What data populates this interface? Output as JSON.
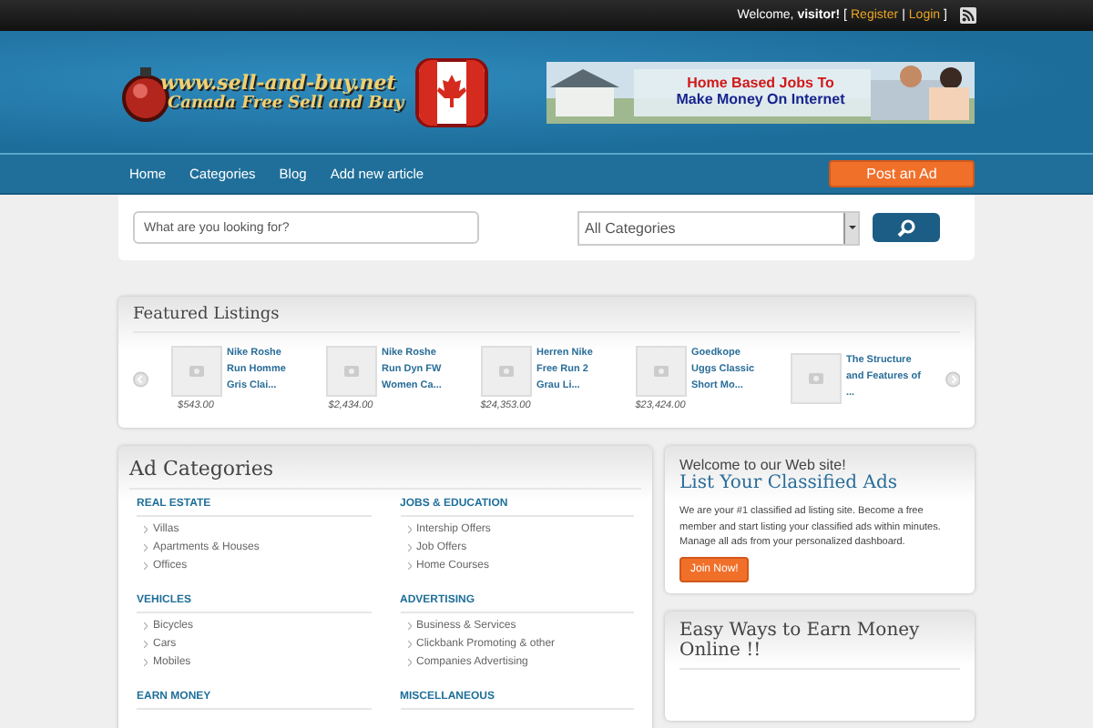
{
  "topbar": {
    "welcome": "Welcome,",
    "user": "visitor!",
    "open_bracket": "[",
    "register": "Register",
    "separator": "|",
    "login": "Login",
    "close_bracket": "]"
  },
  "logo": {
    "site": "www.sell-and-buy.net",
    "tagline": "Canada Free Sell and Buy"
  },
  "banner": {
    "line1": "Home Based Jobs To",
    "line2": "Make Money On Internet"
  },
  "nav": {
    "items": [
      "Home",
      "Categories",
      "Blog",
      "Add new article"
    ],
    "post_button": "Post an Ad"
  },
  "search": {
    "placeholder": "What are you looking for?",
    "category": "All Categories"
  },
  "featured": {
    "title": "Featured Listings",
    "items": [
      {
        "title": "Nike Roshe Run Homme Gris Clai...",
        "price": "$543.00"
      },
      {
        "title": "Nike Roshe Run Dyn FW Women Ca...",
        "price": "$2,434.00"
      },
      {
        "title": "Herren Nike Free Run 2 Grau Li...",
        "price": "$24,353.00"
      },
      {
        "title": "Goedkope Uggs Classic Short Mo...",
        "price": "$23,424.00"
      },
      {
        "title": "The Structure and Features of ..."
      }
    ]
  },
  "categories": {
    "title": "Ad Categories",
    "groups": [
      {
        "name": "REAL ESTATE",
        "items": [
          "Villas",
          "Apartments & Houses",
          "Offices"
        ]
      },
      {
        "name": "JOBS & EDUCATION",
        "items": [
          "Intership Offers",
          "Job Offers",
          "Home Courses"
        ]
      },
      {
        "name": "VEHICLES",
        "items": [
          "Bicycles",
          "Cars",
          "Mobiles"
        ]
      },
      {
        "name": "ADVERTISING",
        "items": [
          "Business & Services",
          "Clickbank Promoting & other",
          "Companies Advertising"
        ]
      },
      {
        "name": "EARN MONEY"
      },
      {
        "name": "MISCELLANEOUS"
      }
    ]
  },
  "welcome_box": {
    "kicker": "Welcome to our Web site!",
    "title": "List Your Classified Ads",
    "text": "We are your #1 classified ad listing site. Become a free member and start listing your classified ads within minutes. Manage all ads from your personalized dashboard.",
    "button": "Join Now!"
  },
  "earn_box": {
    "title": "Easy Ways to Earn Money Online !!"
  }
}
